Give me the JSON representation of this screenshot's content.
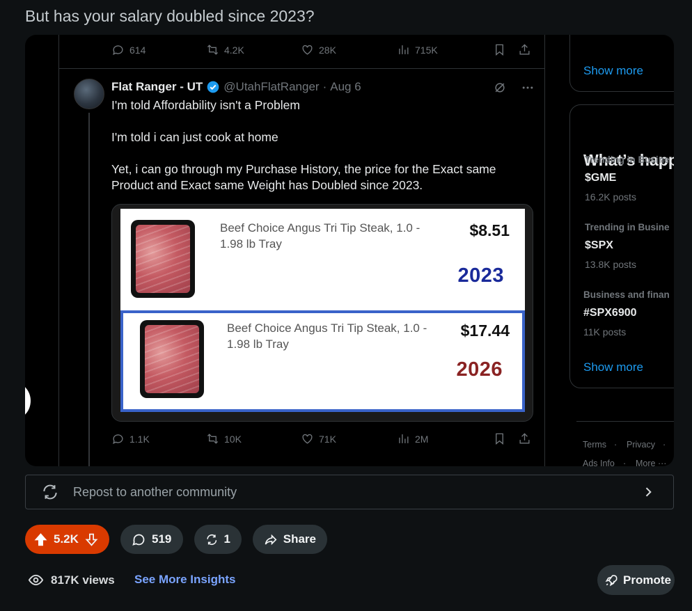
{
  "post": {
    "title": "But has your salary doubled since 2023?"
  },
  "screenshot": {
    "top_actions": {
      "replies": "614",
      "reposts": "4.2K",
      "likes": "28K",
      "views": "715K"
    },
    "tweet": {
      "name": "Flat Ranger - UT",
      "handle": "@UtahFlatRanger",
      "dot": "·",
      "date": "Aug 6",
      "lines": [
        "I'm told Affordability isn't a Problem",
        "I'm told i can just cook at home",
        "Yet, i can go through my Purchase History, the price for the Exact same Product and Exact same Weight has Doubled since 2023."
      ]
    },
    "media": {
      "item_1": {
        "description_l1": "Beef Choice Angus Tri Tip Steak, 1.0 -",
        "description_l2": "1.98 lb Tray",
        "price": "$8.51",
        "year": "2023",
        "year_color": "#1a2a9a"
      },
      "item_2": {
        "description_l1": "Beef Choice Angus Tri Tip Steak, 1.0 -",
        "description_l2": "1.98 lb Tray",
        "price": "$17.44",
        "year": "2026",
        "year_color": "#8a2323"
      }
    },
    "bottom_actions": {
      "replies": "1.1K",
      "reposts": "10K",
      "likes": "71K",
      "views": "2M"
    },
    "sidebar": {
      "show_more_1": "Show more",
      "heading": "What’s happ",
      "trends": [
        {
          "category": "Trending in Busine",
          "name": "$GME",
          "count": "16.2K posts"
        },
        {
          "category": "Trending in Busine",
          "name": "$SPX",
          "count": "13.8K posts"
        },
        {
          "category": "Business and finan",
          "name": "#SPX6900",
          "count": "11K posts"
        }
      ],
      "show_more_2": "Show more",
      "footer": {
        "terms": "Terms",
        "dot1": "·",
        "privacy": "Privacy",
        "dot2": "·",
        "ads": "Ads Info",
        "dot3": "·",
        "more": "More ···"
      }
    }
  },
  "repost_bar": {
    "label": "Repost to another community"
  },
  "actions": {
    "votes": "5.2K",
    "comments": "519",
    "crossposts": "1",
    "share": "Share"
  },
  "stats": {
    "views": "817K views",
    "insights": "See More Insights",
    "promote": "Promote"
  },
  "colors": {
    "upvote_bg": "#d93a00",
    "link": "#7aa4ff",
    "x_blue": "#1d9bf0",
    "page_bg": "#0e1113"
  }
}
